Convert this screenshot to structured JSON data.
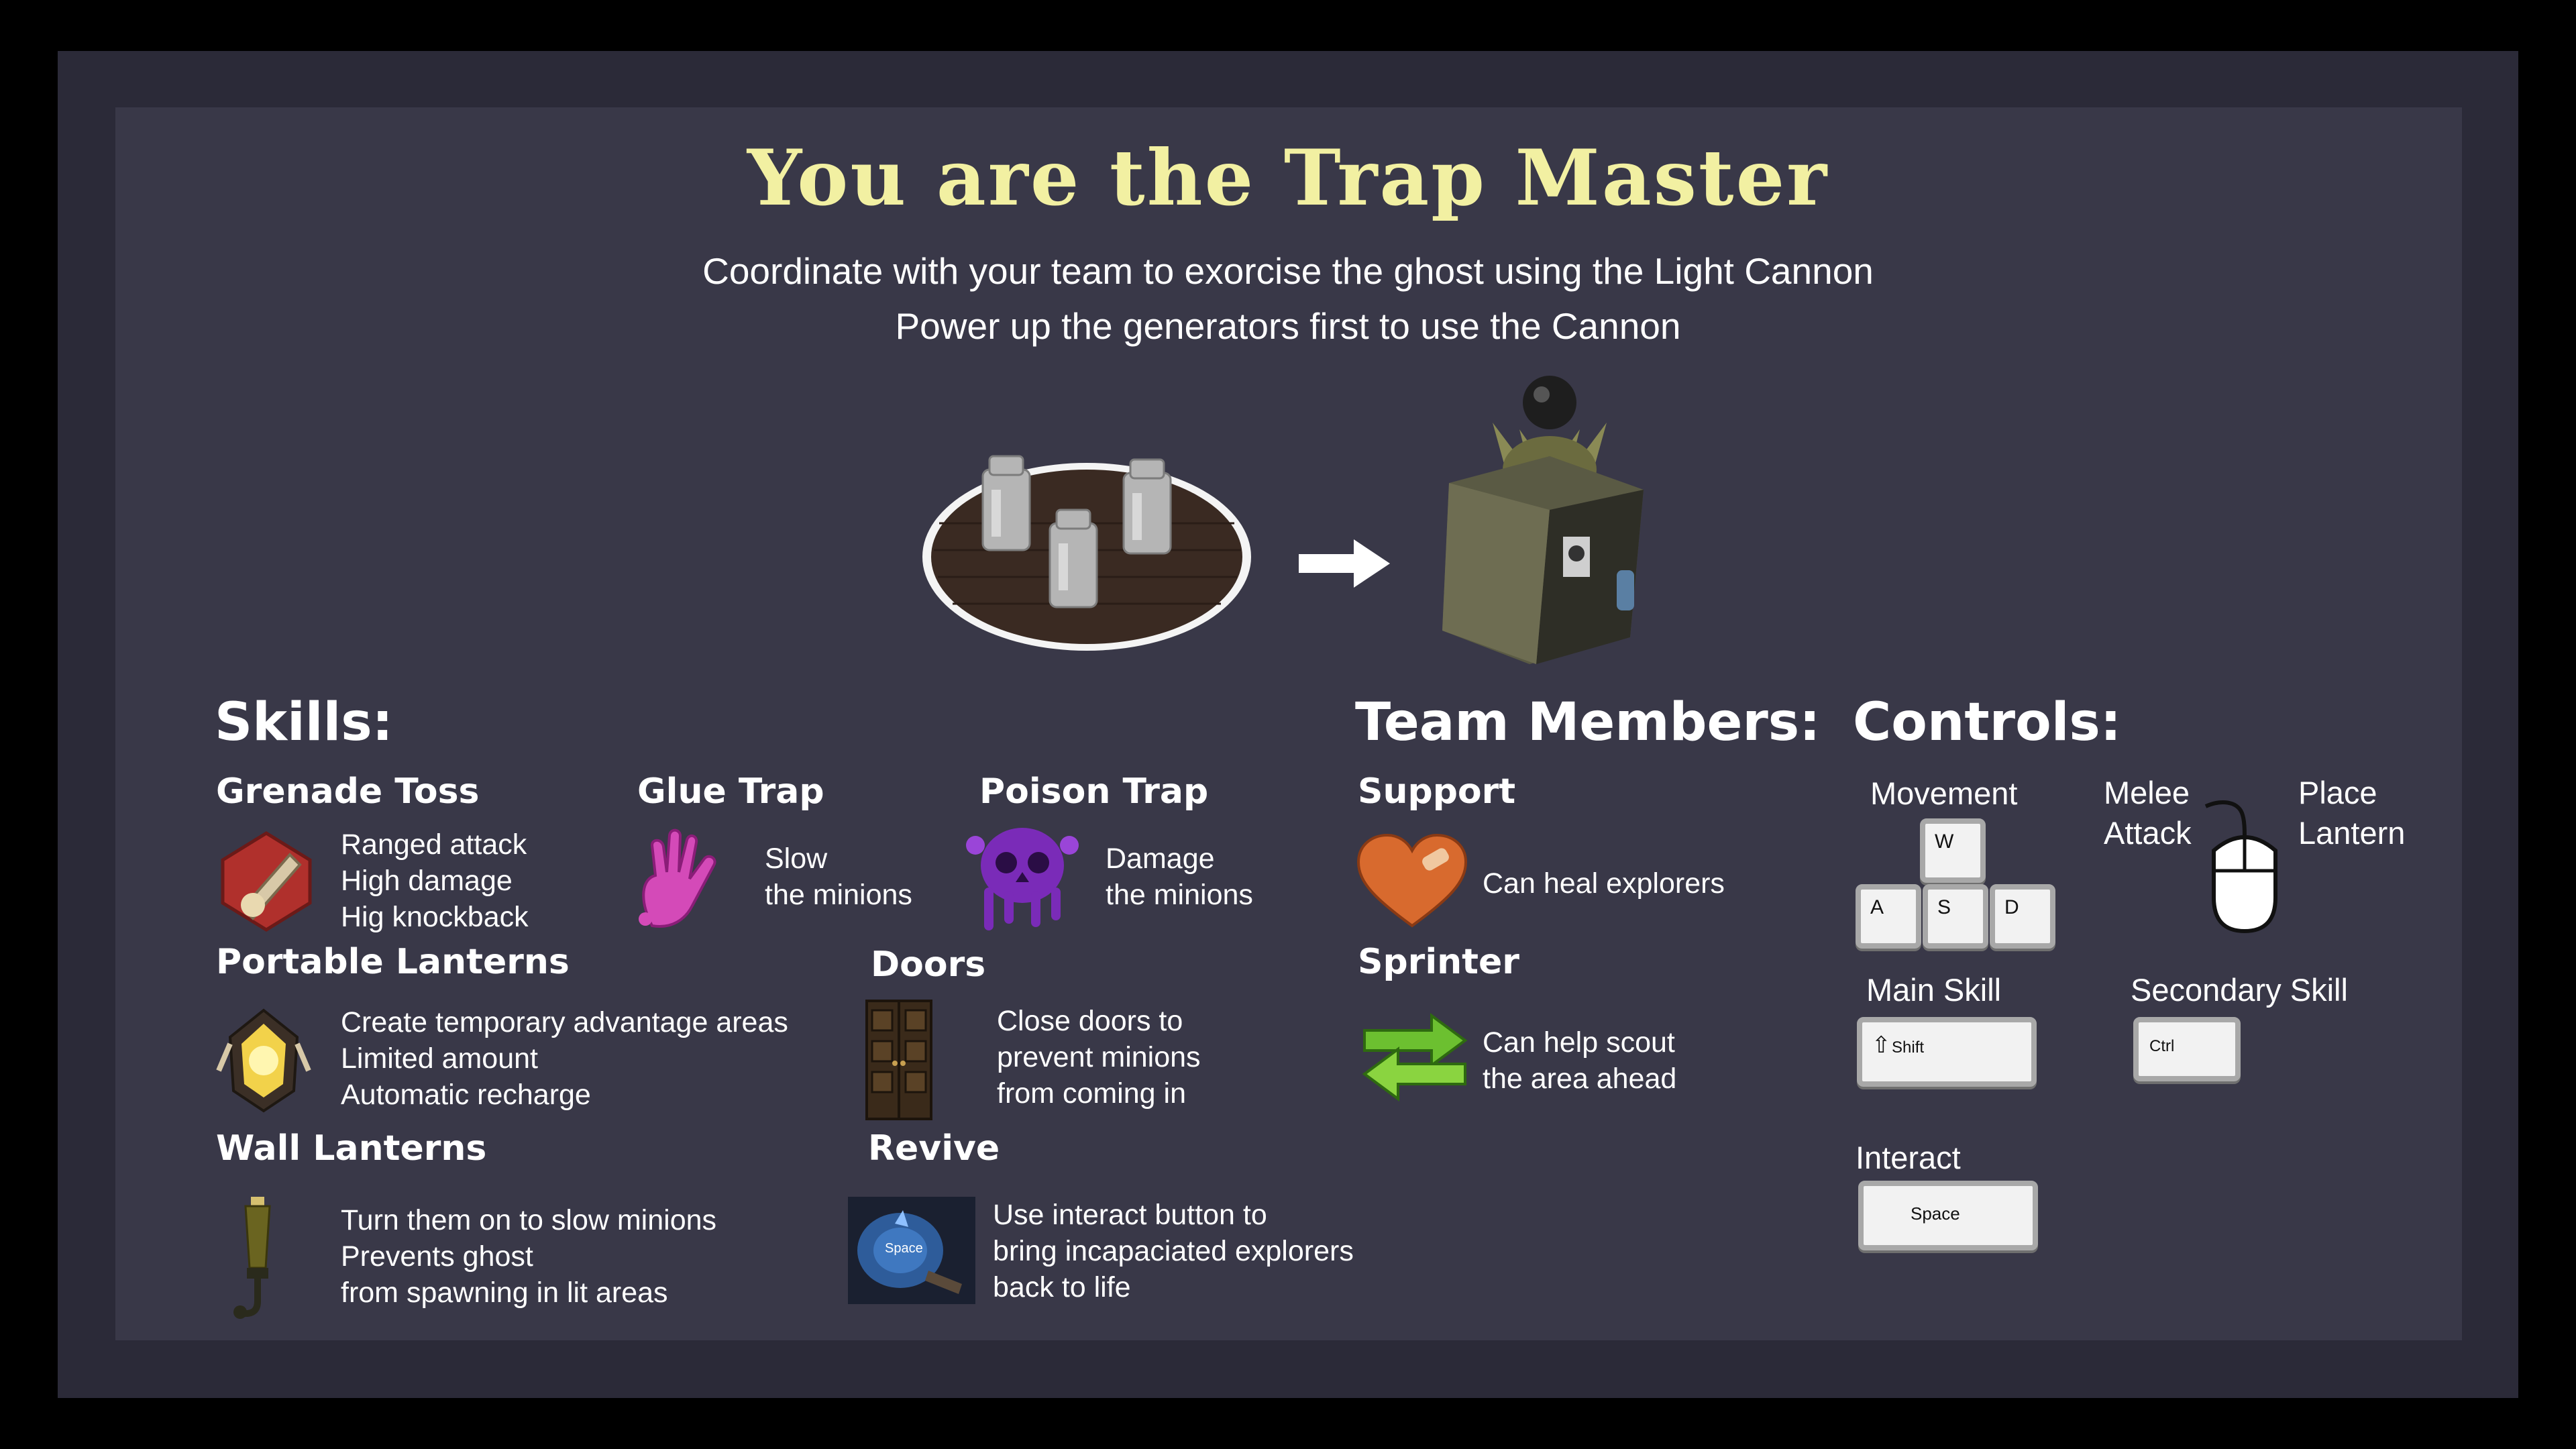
{
  "header": {
    "title": "You are the Trap Master",
    "subtitle_line1": "Coordinate with your team to exorcise the ghost using the Light Cannon",
    "subtitle_line2": "Power up the generators first to use the Cannon"
  },
  "skills": {
    "heading": "Skills:",
    "items": [
      {
        "name": "Grenade Toss",
        "lines": [
          "Ranged attack",
          "High damage",
          "Hig knockback"
        ],
        "icon": "grenade-icon"
      },
      {
        "name": "Glue Trap",
        "lines": [
          "Slow",
          "the minions"
        ],
        "icon": "glue-hand-icon"
      },
      {
        "name": "Poison Trap",
        "lines": [
          "Damage",
          "the minions"
        ],
        "icon": "poison-skull-icon"
      },
      {
        "name": "Portable Lanterns",
        "lines": [
          "Create temporary advantage areas",
          "Limited amount",
          "Automatic recharge"
        ],
        "icon": "lantern-icon"
      },
      {
        "name": "Doors",
        "lines": [
          "Close doors to",
          "prevent minions",
          "from coming in"
        ],
        "icon": "door-icon"
      },
      {
        "name": "Wall Lanterns",
        "lines": [
          "Turn them on to slow minions",
          "Prevents ghost",
          "from spawning in lit areas"
        ],
        "icon": "wall-lantern-icon"
      },
      {
        "name": "Revive",
        "lines": [
          "Use interact button to",
          "bring incapaciated explorers",
          "back to life"
        ],
        "icon": "revive-icon",
        "icon_text": "Space"
      }
    ]
  },
  "team": {
    "heading": "Team Members:",
    "members": [
      {
        "name": "Support",
        "lines": [
          "Can heal explorers"
        ],
        "icon": "heart-icon"
      },
      {
        "name": "Sprinter",
        "lines": [
          "Can help scout",
          "the area ahead"
        ],
        "icon": "double-arrow-icon"
      }
    ]
  },
  "controls": {
    "heading": "Controls:",
    "movement": {
      "label": "Movement",
      "keys": [
        "W",
        "A",
        "S",
        "D"
      ]
    },
    "melee": {
      "label_line1": "Melee",
      "label_line2": "Attack"
    },
    "place": {
      "label_line1": "Place",
      "label_line2": "Lantern"
    },
    "main_skill": {
      "label": "Main Skill",
      "key": "Shift",
      "key_glyph": "⇧"
    },
    "secondary_skill": {
      "label": "Secondary Skill",
      "key": "Ctrl"
    },
    "interact": {
      "label": "Interact",
      "key": "Space"
    }
  },
  "colors": {
    "title": "#f2f0a2",
    "background_outer": "#2b2a38",
    "background_inner": "#393848"
  }
}
